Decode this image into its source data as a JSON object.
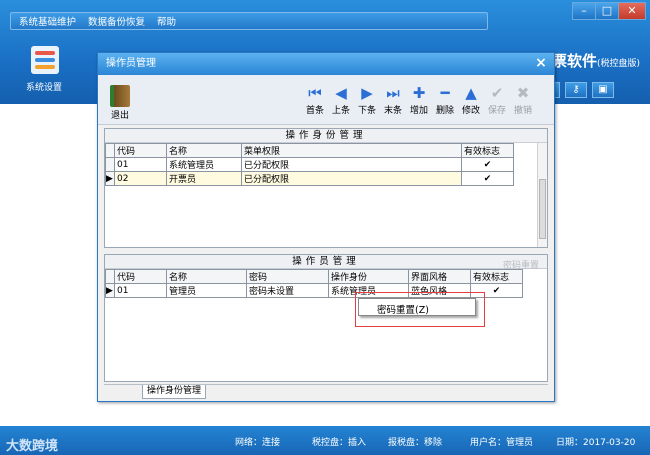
{
  "menu": [
    "系统基础维护",
    "数据备份恢复",
    "帮助"
  ],
  "window_controls": [
    "–",
    "□",
    "✕"
  ],
  "sys_tile_label": "系统设置",
  "brand": {
    "main": "票软件",
    "sub": "(税控盘版)"
  },
  "dialog": {
    "title": "操作员管理",
    "close": "×",
    "exit_label": "退出",
    "toolbar": [
      {
        "label": "首条",
        "icon": "first-icon",
        "glyph": "⏮"
      },
      {
        "label": "上条",
        "icon": "prev-icon",
        "glyph": "◀"
      },
      {
        "label": "下条",
        "icon": "next-icon",
        "glyph": "▶"
      },
      {
        "label": "末条",
        "icon": "last-icon",
        "glyph": "⏭"
      },
      {
        "label": "增加",
        "icon": "add-icon",
        "glyph": "✚"
      },
      {
        "label": "删除",
        "icon": "delete-icon",
        "glyph": "━"
      },
      {
        "label": "修改",
        "icon": "edit-icon",
        "glyph": "▲"
      },
      {
        "label": "保存",
        "icon": "save-icon",
        "glyph": "✔",
        "disabled": true
      },
      {
        "label": "撤销",
        "icon": "undo-icon",
        "glyph": "✖",
        "disabled": true
      }
    ],
    "roles_panel": {
      "title": "操作身份管理",
      "headers": [
        "代码",
        "名称",
        "菜单权限",
        "有效标志"
      ],
      "rows": [
        {
          "code": "01",
          "name": "系统管理员",
          "perm": "已分配权限",
          "valid": "✔"
        },
        {
          "code": "02",
          "name": "开票员",
          "perm": "已分配权限",
          "valid": "✔"
        }
      ]
    },
    "operators_panel": {
      "title": "操作员管理",
      "reset_link": "密码重置",
      "headers": [
        "代码",
        "名称",
        "密码",
        "操作身份",
        "界面风格",
        "有效标志"
      ],
      "rows": [
        {
          "code": "01",
          "name": "管理员",
          "password": "密码未设置",
          "role": "系统管理员",
          "style": "蓝色风格",
          "valid": "✔"
        }
      ]
    },
    "bottom_tab": "操作身份管理"
  },
  "context_menu": {
    "item": "密码重置(Z)"
  },
  "status": {
    "logo": "大数跨境",
    "network": "网络：连接",
    "taxdisk": "税控盘：插入",
    "taxdisk2": "报税盘：移除",
    "user": "用户名：管理员",
    "date": "日期：2017-03-20"
  }
}
